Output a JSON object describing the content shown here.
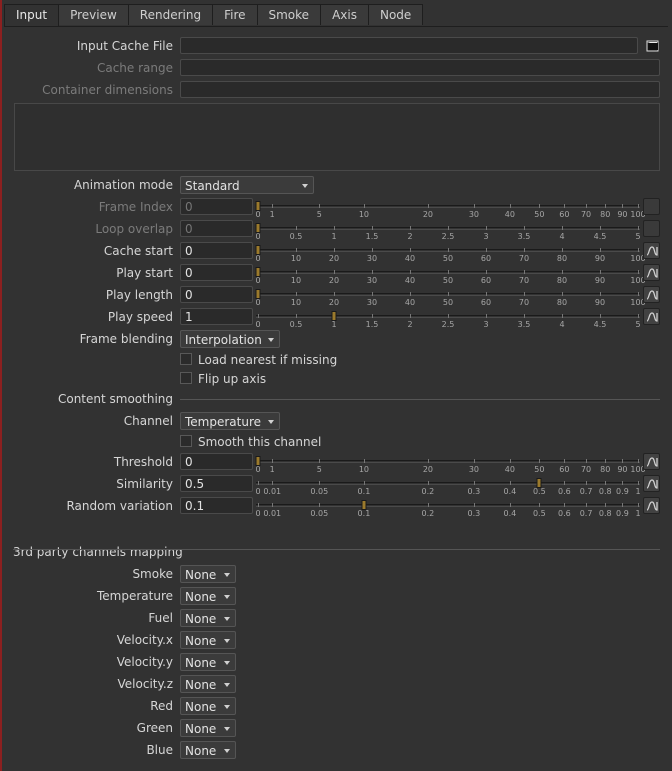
{
  "tabs": [
    "Input",
    "Preview",
    "Rendering",
    "Fire",
    "Smoke",
    "Axis",
    "Node"
  ],
  "active_tab": "Input",
  "input": {
    "cache_file_label": "Input Cache File",
    "cache_file_value": "",
    "cache_range_label": "Cache range",
    "container_dimensions_label": "Container dimensions"
  },
  "animation": {
    "mode_label": "Animation mode",
    "mode_value": "Standard",
    "frame_index_label": "Frame Index",
    "frame_index_value": "0",
    "loop_overlap_label": "Loop overlap",
    "loop_overlap_value": "0",
    "cache_start_label": "Cache start",
    "cache_start_value": "0",
    "play_start_label": "Play start",
    "play_start_value": "0",
    "play_length_label": "Play length",
    "play_length_value": "0",
    "play_speed_label": "Play speed",
    "play_speed_value": "1",
    "frame_blending_label": "Frame blending",
    "frame_blending_value": "Interpolation",
    "load_nearest_label": "Load nearest if missing",
    "flip_up_label": "Flip up axis"
  },
  "smoothing": {
    "section_title": "Content smoothing",
    "channel_label": "Channel",
    "channel_value": "Temperature",
    "smooth_label": "Smooth this channel",
    "threshold_label": "Threshold",
    "threshold_value": "0",
    "similarity_label": "Similarity",
    "similarity_value": "0.5",
    "random_label": "Random variation",
    "random_value": "0.1"
  },
  "mapping": {
    "section_title": "3rd party channels mapping",
    "rows": [
      {
        "label": "Smoke",
        "value": "None"
      },
      {
        "label": "Temperature",
        "value": "None"
      },
      {
        "label": "Fuel",
        "value": "None"
      },
      {
        "label": "Velocity.x",
        "value": "None"
      },
      {
        "label": "Velocity.y",
        "value": "None"
      },
      {
        "label": "Velocity.z",
        "value": "None"
      },
      {
        "label": "Red",
        "value": "None"
      },
      {
        "label": "Green",
        "value": "None"
      },
      {
        "label": "Blue",
        "value": "None"
      }
    ]
  },
  "scales": {
    "log100": [
      "0",
      "1",
      "5",
      "10",
      "20",
      "30",
      "40",
      "50",
      "60",
      "70",
      "80",
      "90",
      "100"
    ],
    "lin5": [
      "0",
      "0.5",
      "1",
      "1.5",
      "2",
      "2.5",
      "3",
      "3.5",
      "4",
      "4.5",
      "5"
    ],
    "lin100": [
      "0",
      "10",
      "20",
      "30",
      "40",
      "50",
      "60",
      "70",
      "80",
      "90",
      "100"
    ],
    "log1": [
      "0",
      "0.01",
      "0.05",
      "0.1",
      "0.2",
      "0.3",
      "0.4",
      "0.5",
      "0.6",
      "0.7",
      "0.8",
      "0.9",
      "1"
    ]
  },
  "icons": {
    "folder": "folder-icon",
    "animation": "animation-curve-icon"
  },
  "colors": {
    "background": "#323232",
    "field": "#2a2a2a",
    "slider_handle": "#9b7a2c",
    "accent_edge": "#8c2020"
  }
}
